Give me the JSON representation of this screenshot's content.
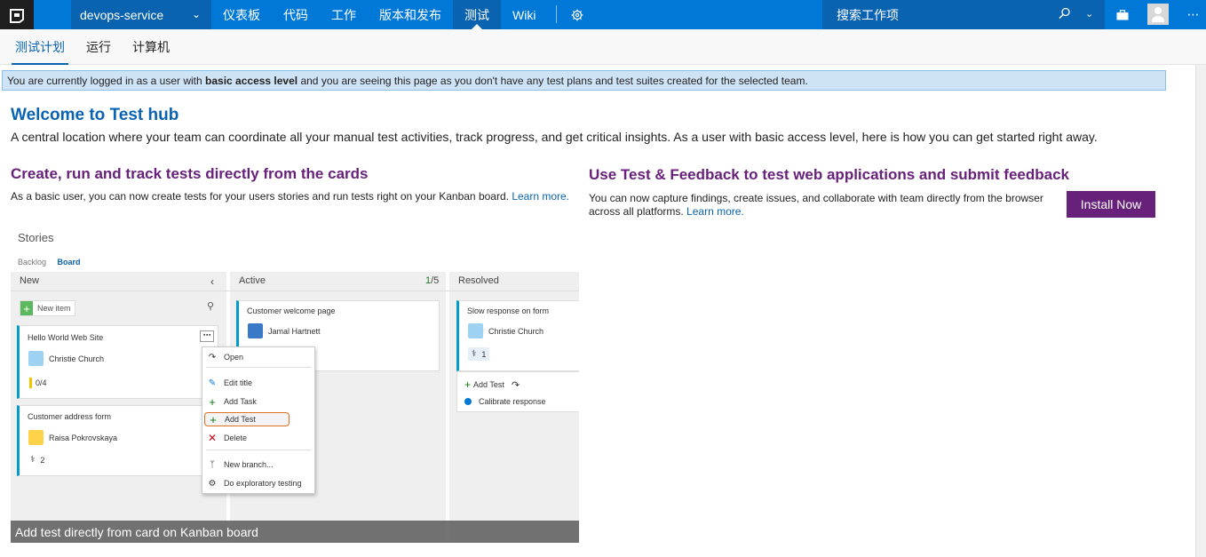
{
  "topbar": {
    "project": "devops-service",
    "nav": [
      "仪表板",
      "代码",
      "工作",
      "版本和发布",
      "测试",
      "Wiki"
    ],
    "search_placeholder": "搜索工作项"
  },
  "subnav": [
    "测试计划",
    "运行",
    "计算机"
  ],
  "banner": {
    "pre": "You are currently logged in as a user with ",
    "bold": "basic access level",
    "post": " and you are seeing this page as you don't have any test plans and test suites created for the selected team."
  },
  "main": {
    "title": "Welcome to Test hub",
    "intro": "A central location where your team can coordinate all your manual test activities, track progress, and get critical insights. As a user with basic access level, here is how you can get started right away.",
    "left_heading": "Create, run and track tests directly from the cards",
    "left_text": "As a basic user, you can now create tests for your users stories and run tests right on your Kanban board.",
    "left_link": "Learn more.",
    "right_heading": "Use Test & Feedback to test web applications and submit feedback",
    "right_text": "You can now capture findings, create issues, and collaborate with team directly from the browser across all platforms.",
    "right_link": "Learn more.",
    "install_button": "Install Now"
  },
  "board": {
    "title": "Stories",
    "tab_backlog": "Backlog",
    "tab_board": "Board",
    "col_new": "New",
    "col_active": "Active",
    "col_active_count": "1",
    "col_active_limit": "/5",
    "col_resolved": "Resolved",
    "new_item": "New item",
    "cards": {
      "c1_title": "Hello World Web Site",
      "c1_person": "Christie Church",
      "c1_progress": "0/4",
      "c2_title": "Customer address form",
      "c2_person": "Raisa Pokrovskaya",
      "c2_tests": "2",
      "c3_title": "Customer welcome page",
      "c3_person": "Jamal Hartnett",
      "c4_title": "Slow response on form",
      "c4_person": "Christie Church",
      "c4_tests": "1"
    },
    "add_test": "Add Test",
    "calibrate": "Calibrate response",
    "menu": [
      "Open",
      "Edit title",
      "Add Task",
      "Add Test",
      "Delete",
      "New branch...",
      "Do exploratory testing"
    ],
    "caption": "Add test directly from card on Kanban board"
  },
  "colors": {
    "accent": "#0078d7",
    "purple": "#68217a",
    "highlight": "#e07020"
  }
}
